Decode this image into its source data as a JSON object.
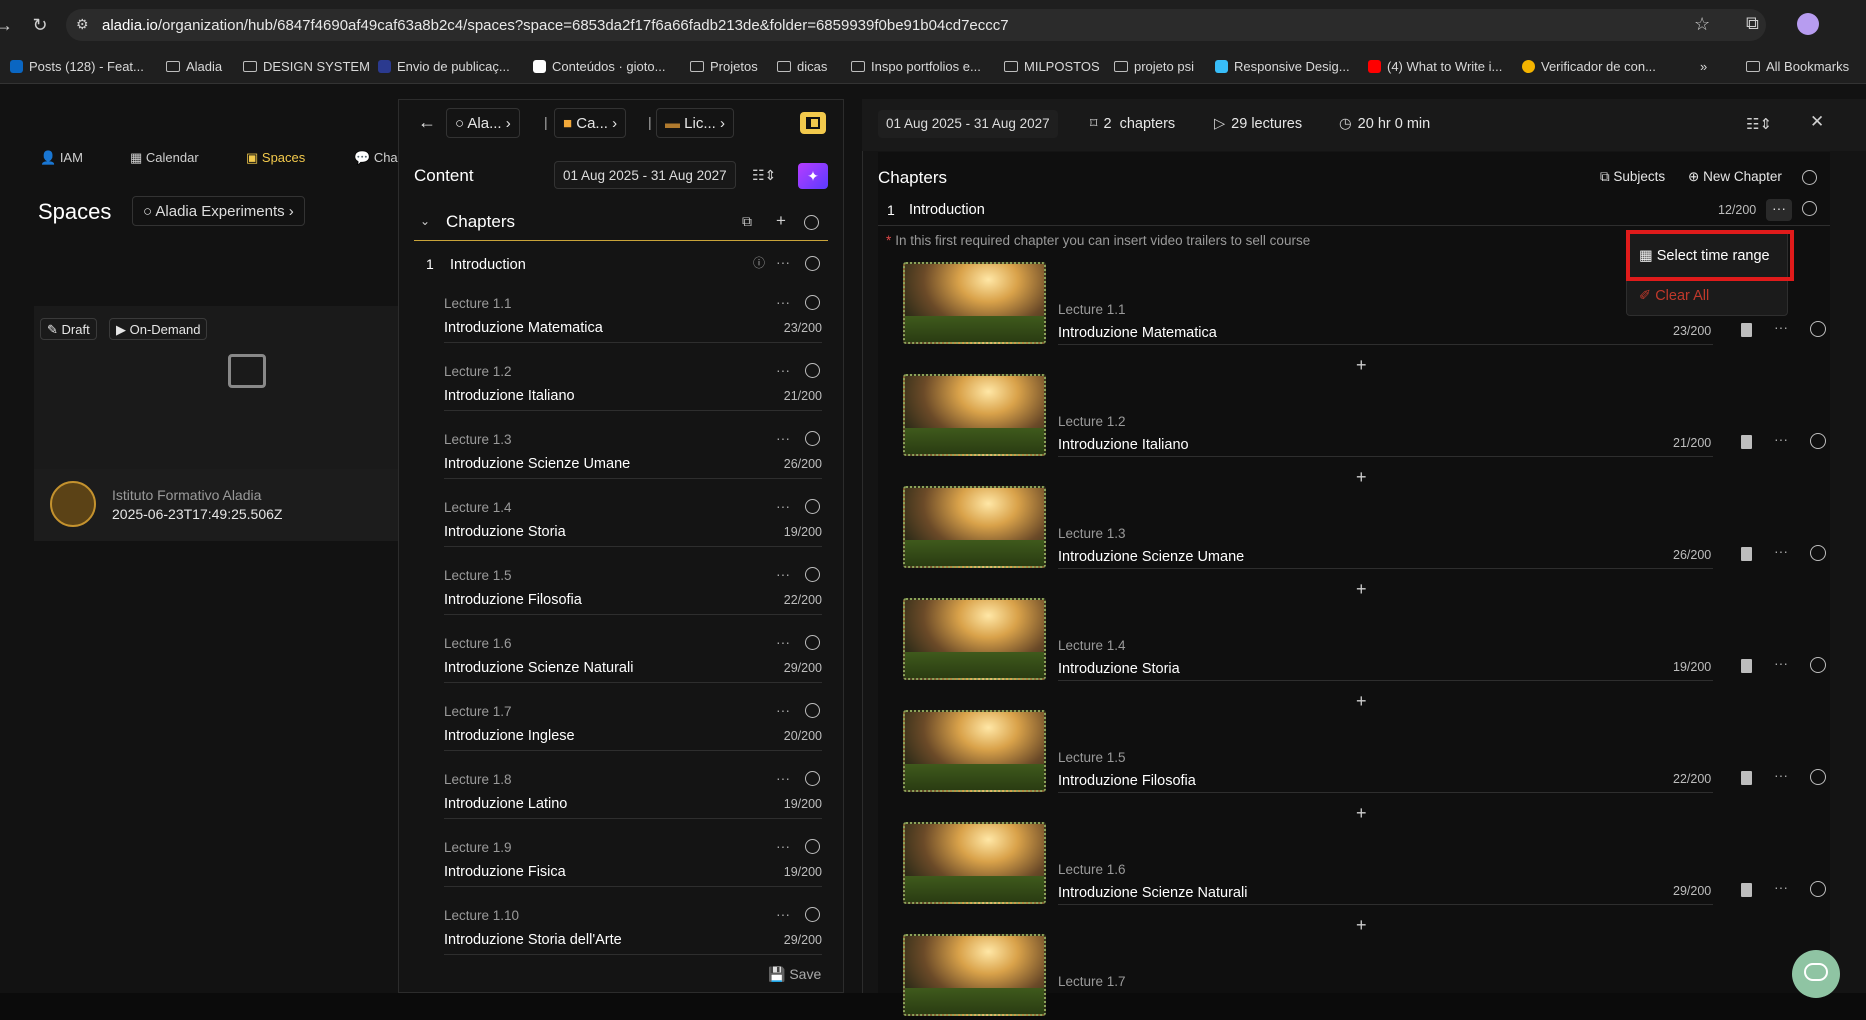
{
  "browser": {
    "url_host": "aladia.io",
    "url_path": "/organization/hub/6847f4690af49caf63a8b2c4/spaces?space=6853da2f17f6a66fadb213de&folder=6859939f0be91b04cd7eccc7",
    "bookmarks": [
      "Posts (128) - Feat...",
      "Aladia",
      "DESIGN SYSTEM",
      "Envio de publicaç...",
      "Conteúdos · gioto...",
      "Projetos",
      "dicas",
      "Inspo portfolios e...",
      "MILPOSTOS",
      "projeto psi",
      "Responsive Desig...",
      "(4) What to Write i...",
      "Verificador de con..."
    ],
    "more": "»",
    "all_bookmarks": "All Bookmarks"
  },
  "background": {
    "tabs": [
      "IAM",
      "Calendar",
      "Spaces",
      "Cha"
    ],
    "spaces_title": "Spaces",
    "crumb": "Aladia Experiments",
    "badges": [
      "Draft",
      "On-Demand"
    ],
    "institute": "Istituto Formativo Aladia",
    "institute_date": "2025-06-23T17:49:25.506Z"
  },
  "left_panel": {
    "crumbs": [
      "Ala...",
      "Ca...",
      "Lic..."
    ],
    "content_title": "Content",
    "date_range": "01 Aug 2025 - 31 Aug 2027",
    "chapters_label": "Chapters",
    "chapter": {
      "number": "1",
      "title": "Introduction"
    },
    "lectures": [
      {
        "num": "Lecture 1.1",
        "title": "Introduzione Matematica",
        "count": "23/200"
      },
      {
        "num": "Lecture 1.2",
        "title": "Introduzione Italiano",
        "count": "21/200"
      },
      {
        "num": "Lecture 1.3",
        "title": "Introduzione Scienze Umane",
        "count": "26/200"
      },
      {
        "num": "Lecture 1.4",
        "title": "Introduzione Storia",
        "count": "19/200"
      },
      {
        "num": "Lecture 1.5",
        "title": "Introduzione Filosofia",
        "count": "22/200"
      },
      {
        "num": "Lecture 1.6",
        "title": "Introduzione Scienze Naturali",
        "count": "29/200"
      },
      {
        "num": "Lecture 1.7",
        "title": "Introduzione Inglese",
        "count": "20/200"
      },
      {
        "num": "Lecture 1.8",
        "title": "Introduzione Latino",
        "count": "19/200"
      },
      {
        "num": "Lecture 1.9",
        "title": "Introduzione Fisica",
        "count": "19/200"
      },
      {
        "num": "Lecture 1.10",
        "title": "Introduzione Storia dell'Arte",
        "count": "29/200"
      }
    ],
    "save_label": "Save"
  },
  "right_panel": {
    "date_range": "01 Aug 2025 - 31 Aug 2027",
    "chapters_count": "2",
    "chapters_word": "chapters",
    "lectures_stat": "29 lectures",
    "duration_stat": "20 hr 0 min",
    "title": "Chapters",
    "subjects_label": "Subjects",
    "new_chapter_label": "New Chapter",
    "chapter": {
      "number": "1",
      "title": "Introduction",
      "count": "12/200"
    },
    "hint": "In this first required chapter you can insert video trailers to sell course",
    "lectures": [
      {
        "num": "Lecture 1.1",
        "title": "Introduzione Matematica",
        "count": "23/200"
      },
      {
        "num": "Lecture 1.2",
        "title": "Introduzione Italiano",
        "count": "21/200"
      },
      {
        "num": "Lecture 1.3",
        "title": "Introduzione Scienze Umane",
        "count": "26/200"
      },
      {
        "num": "Lecture 1.4",
        "title": "Introduzione Storia",
        "count": "19/200"
      },
      {
        "num": "Lecture 1.5",
        "title": "Introduzione Filosofia",
        "count": "22/200"
      },
      {
        "num": "Lecture 1.6",
        "title": "Introduzione Scienze Naturali",
        "count": "29/200"
      },
      {
        "num": "Lecture 1.7",
        "title": "",
        "count": ""
      }
    ],
    "dropdown": {
      "select_time_range": "Select time range",
      "clear_all": "Clear All"
    }
  },
  "colors": {
    "accent": "#f2c94c",
    "danger": "#e01b1b",
    "clear_all": "#c0392b"
  }
}
